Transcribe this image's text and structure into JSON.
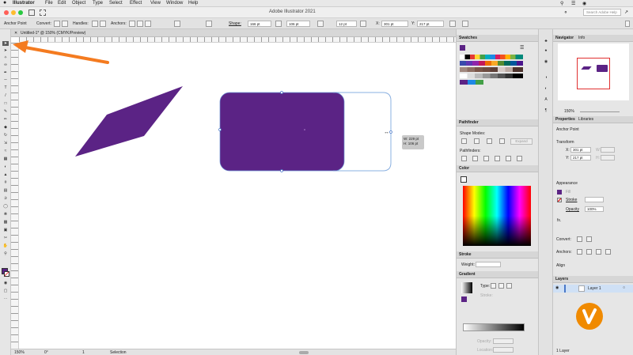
{
  "menubar": {
    "apple": "",
    "app": "Illustrator",
    "items": [
      "File",
      "Edit",
      "Object",
      "Type",
      "Select",
      "Effect",
      "View",
      "Window",
      "Help"
    ]
  },
  "appbar": {
    "title": "Adobe Illustrator 2021",
    "search_placeholder": "Search Adobe Help"
  },
  "control": {
    "mode": "Anchor Point",
    "convert": "Convert:",
    "handles": "Handles:",
    "anchors": "Anchors:",
    "shape": "Shape:",
    "shape_w": "166 pt",
    "shape_h": "106 pt",
    "corner": "12 pt",
    "x_label": "X:",
    "x": "301 pt",
    "y_label": "Y:",
    "y": "217 pt"
  },
  "document": {
    "tab_label": "Untitled-1* @ 150% (CMYK/Preview)"
  },
  "tooltip": {
    "w": "W: 229 pt",
    "h": "H: 106 pt"
  },
  "status": {
    "zoom": "150%",
    "rotate": "0°",
    "page": "1",
    "tool": "Selection"
  },
  "swatches": {
    "title": "Swatches"
  },
  "pathfinder": {
    "title": "Pathfinder",
    "shape_modes": "Shape Modes:",
    "pathfinders": "Pathfinders:",
    "expand": "Expand"
  },
  "color": {
    "title": "Color"
  },
  "stroke": {
    "title": "Stroke",
    "weight": "Weight:"
  },
  "gradient": {
    "title": "Gradient",
    "type": "Type:",
    "stroke": "Stroke:",
    "opacity": "Opacity:",
    "location": "Location:"
  },
  "navigator": {
    "tabs": [
      "Navigator",
      "Info"
    ],
    "zoom": "150%"
  },
  "properties": {
    "tabs": [
      "Properties",
      "Libraries"
    ],
    "subtitle": "Anchor Point",
    "transform": "Transform",
    "x_label": "X:",
    "x": "301 pt",
    "y_label": "Y:",
    "y": "217 pt",
    "w_label": "W:",
    "h_label": "H:",
    "appearance": "Appearance",
    "fill": "Fill",
    "stroke": "Stroke",
    "opacity": "Opacity",
    "opacity_val": "100%",
    "fx": "fx.",
    "convert": "Convert:",
    "anchors": "Anchors:",
    "align": "Align"
  },
  "layers": {
    "title": "Layers",
    "layer_name": "Layer 1",
    "count": "1 Layer"
  },
  "colors": {
    "purple": "#5b2385",
    "accent": "#f47b20",
    "ui": "#e6e6e6"
  }
}
